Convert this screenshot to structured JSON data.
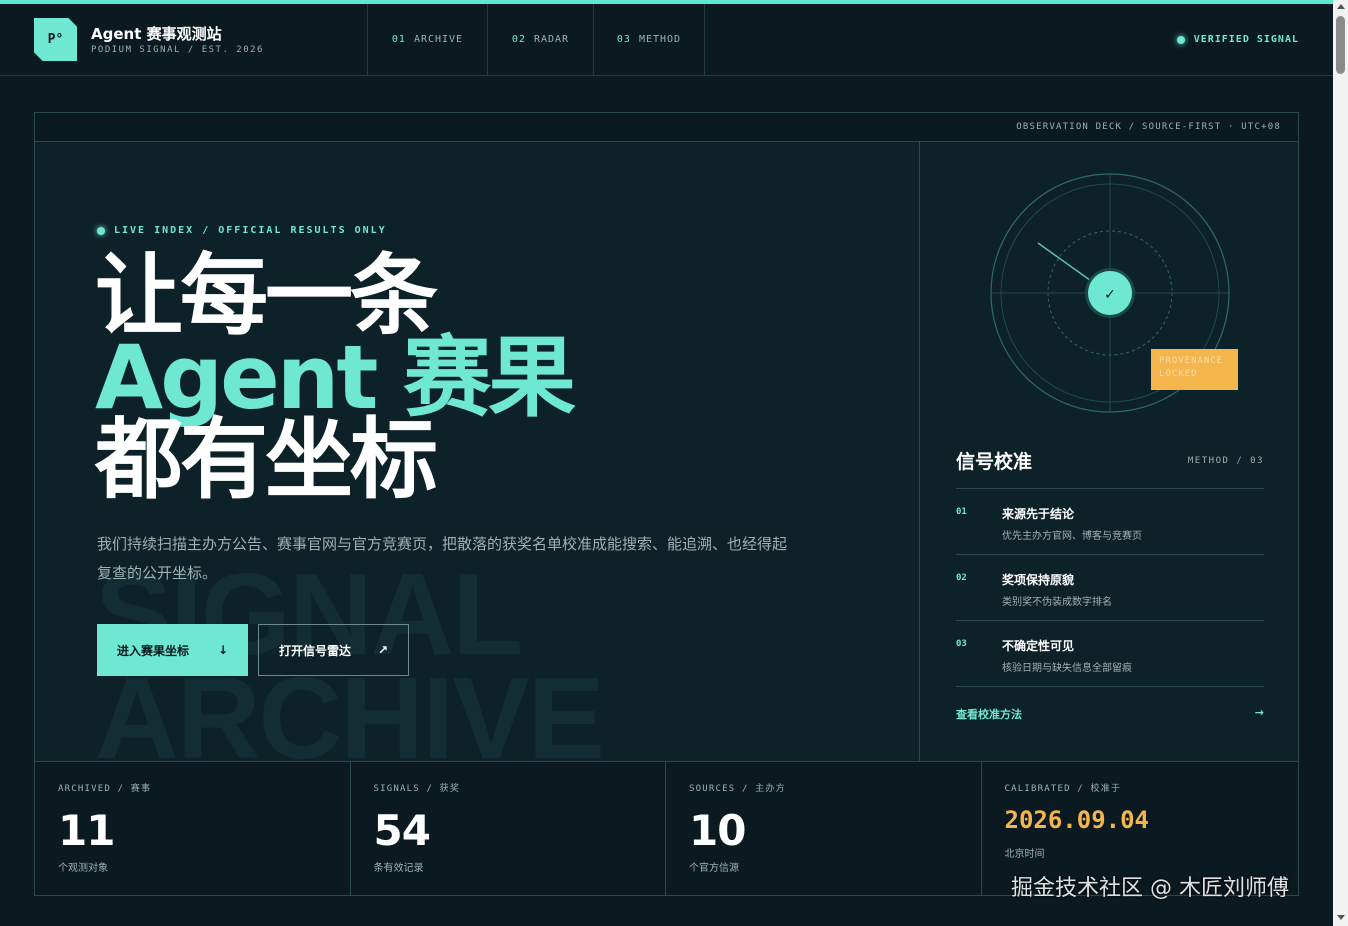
{
  "brand": {
    "logo": "P°",
    "title": "Agent 赛事观测站",
    "subtitle": "PODIUM SIGNAL / EST. 2026"
  },
  "nav": [
    {
      "num": "01",
      "label": "ARCHIVE"
    },
    {
      "num": "02",
      "label": "RADAR"
    },
    {
      "num": "03",
      "label": "METHOD"
    }
  ],
  "status": {
    "label": "VERIFIED SIGNAL",
    "color": "#6ee8d2"
  },
  "deck": "OBSERVATION DECK / SOURCE-FIRST · UTC+08",
  "hero": {
    "live_tag": "LIVE INDEX / OFFICIAL RESULTS ONLY",
    "headline_1": "让每一条",
    "headline_2": "Agent 赛果",
    "headline_3": "都有坐标",
    "bg_text_1": "SIGNAL",
    "bg_text_2": "ARCHIVE",
    "description": "我们持续扫描主办方公告、赛事官网与官方竞赛页，把散落的获奖名单校准成能搜索、能追溯、也经得起复查的公开坐标。",
    "primary_button": "进入赛果坐标",
    "primary_icon": "↓",
    "secondary_button": "打开信号雷达",
    "secondary_icon": "↗"
  },
  "radar": {
    "center_icon": "✓",
    "badge_line1": "PROVENANCE",
    "badge_line2": "LOCKED"
  },
  "signals": {
    "title": "信号校准",
    "meta": "METHOD / 03",
    "items": [
      {
        "num": "01",
        "name": "来源先于结论",
        "desc": "优先主办方官网、博客与竞赛页"
      },
      {
        "num": "02",
        "name": "奖项保持原貌",
        "desc": "类别奖不伪装成数字排名"
      },
      {
        "num": "03",
        "name": "不确定性可见",
        "desc": "核验日期与缺失信息全部留痕"
      }
    ],
    "link": "查看校准方法",
    "link_icon": "→"
  },
  "stats": [
    {
      "label": "ARCHIVED / 赛事",
      "value": "11",
      "sub": "个观测对象"
    },
    {
      "label": "SIGNALS / 获奖",
      "value": "54",
      "sub": "条有效记录"
    },
    {
      "label": "SOURCES / 主办方",
      "value": "10",
      "sub": "个官方信源"
    },
    {
      "label": "CALIBRATED / 校准于",
      "value": "2026.09.04",
      "sub": "北京时间"
    }
  ],
  "watermark": "掘金技术社区 @ 木匠刘师傅",
  "colors": {
    "accent": "#6ee8d2",
    "warning": "#f5b54d",
    "background": "#0a1a20"
  }
}
